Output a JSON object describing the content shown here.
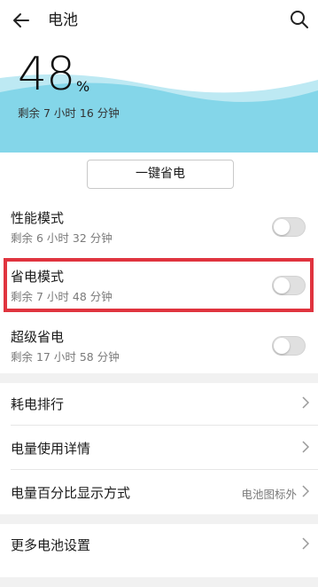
{
  "header": {
    "title": "电池"
  },
  "battery": {
    "percent": "48",
    "percent_sign": "%",
    "remaining": "剩余 7 小时 16 分钟"
  },
  "one_key_button": "一键省电",
  "modes": [
    {
      "name": "性能模式",
      "remaining": "剩余 6 小时 32 分钟",
      "enabled": false
    },
    {
      "name": "省电模式",
      "remaining": "剩余 7 小时 48 分钟",
      "enabled": false
    },
    {
      "name": "超级省电",
      "remaining": "剩余 17 小时 58 分钟",
      "enabled": false
    }
  ],
  "rows": [
    {
      "label": "耗电排行",
      "value": ""
    },
    {
      "label": "电量使用详情",
      "value": ""
    },
    {
      "label": "电量百分比显示方式",
      "value": "电池图标外"
    },
    {
      "label": "更多电池设置",
      "value": ""
    }
  ],
  "colors": {
    "wave_light": "#bde9f3",
    "wave_main": "#84d6e9",
    "highlight": "#e0343f"
  }
}
